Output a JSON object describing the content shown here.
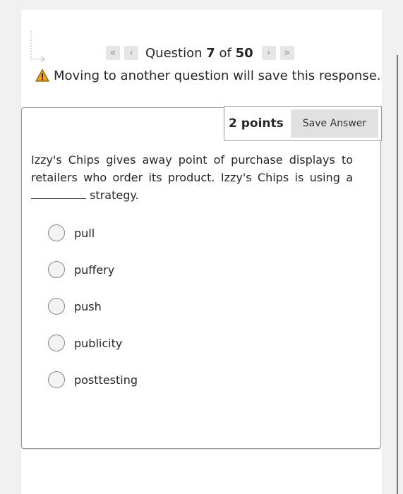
{
  "navigation": {
    "first_icon": "«",
    "prev_icon": "‹",
    "next_icon": "›",
    "last_icon": "»",
    "question_word": "Question",
    "current": "7",
    "of_word": "of",
    "total": "50"
  },
  "warning": {
    "icon": "warning-triangle-icon",
    "text": "Moving to another question will save this response."
  },
  "question": {
    "points": "2 points",
    "save_label": "Save Answer",
    "text_before": "Izzy's Chips gives away point of purchase displays to retailers who order its product. Izzy's Chips is using a ",
    "text_after": " strategy.",
    "options": [
      {
        "label": "pull"
      },
      {
        "label": "puffery"
      },
      {
        "label": "push"
      },
      {
        "label": "publicity"
      },
      {
        "label": "posttesting"
      }
    ]
  },
  "colors": {
    "background": "#f0f0f0",
    "panel": "#ffffff",
    "button_bg": "#e1e1e1",
    "warning_orange": "#f0a020"
  }
}
